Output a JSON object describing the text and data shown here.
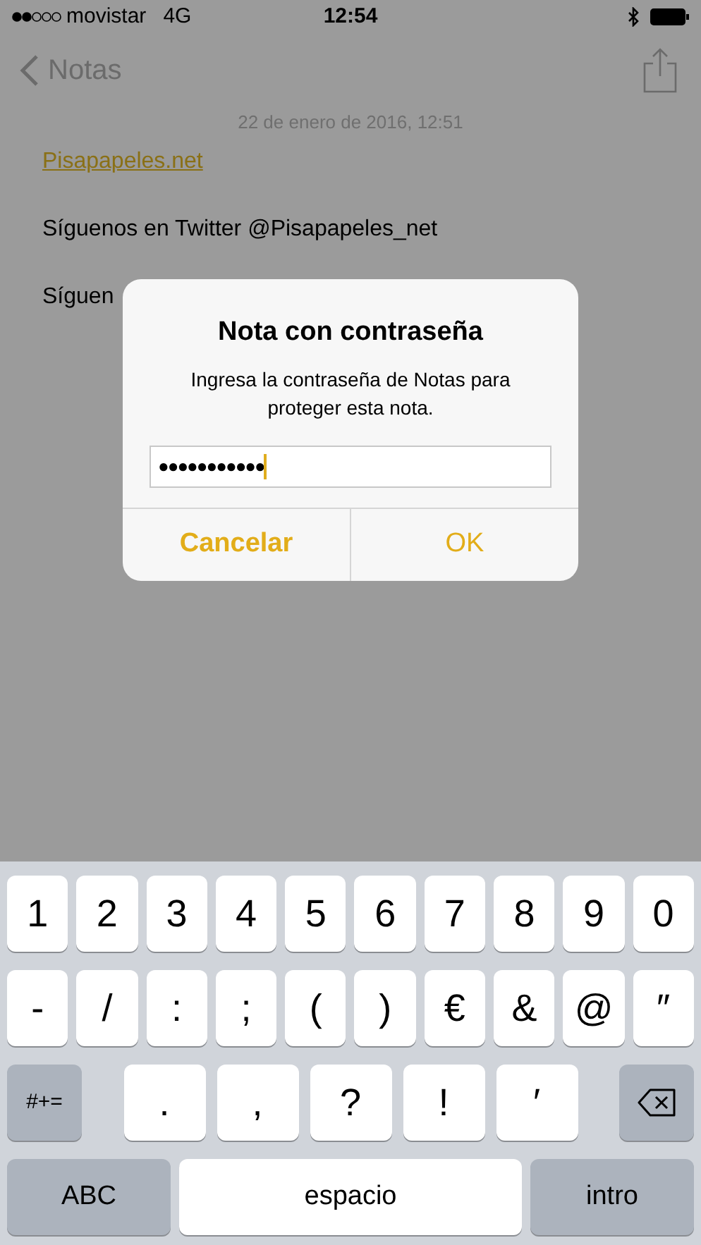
{
  "status_bar": {
    "carrier": "movistar",
    "network": "4G",
    "time": "12:54"
  },
  "nav": {
    "back": "Notas"
  },
  "note": {
    "date": "22 de enero de 2016, 12:51",
    "lines": [
      {
        "kind": "link",
        "text": "Pisapapeles.net"
      },
      {
        "kind": "text",
        "text": "Síguenos en Twitter @Pisapapeles_net"
      },
      {
        "kind": "text",
        "text": "Síguen"
      }
    ]
  },
  "dialog": {
    "title": "Nota con contraseña",
    "message": "Ingresa la contraseña de Notas para proteger esta nota.",
    "password": {
      "value": "●●●●●●●●●●●"
    },
    "buttons": [
      {
        "label": "Cancelar",
        "kind": "cancel"
      },
      {
        "label": "OK",
        "kind": "default"
      }
    ]
  },
  "keyboard": {
    "rows": [
      {
        "keys": [
          {
            "kind": "char",
            "label": "1"
          },
          {
            "kind": "char",
            "label": "2"
          },
          {
            "kind": "char",
            "label": "3"
          },
          {
            "kind": "char",
            "label": "4"
          },
          {
            "kind": "char",
            "label": "5"
          },
          {
            "kind": "char",
            "label": "6"
          },
          {
            "kind": "char",
            "label": "7"
          },
          {
            "kind": "char",
            "label": "8"
          },
          {
            "kind": "char",
            "label": "9"
          },
          {
            "kind": "char",
            "label": "0"
          }
        ]
      },
      {
        "keys": [
          {
            "kind": "char",
            "label": "-"
          },
          {
            "kind": "char",
            "label": "/"
          },
          {
            "kind": "char",
            "label": ":"
          },
          {
            "kind": "char",
            "label": ";"
          },
          {
            "kind": "char",
            "label": "("
          },
          {
            "kind": "char",
            "label": ")"
          },
          {
            "kind": "char",
            "label": "€"
          },
          {
            "kind": "char",
            "label": "&"
          },
          {
            "kind": "char",
            "label": "@"
          },
          {
            "kind": "char",
            "label": "″"
          }
        ]
      },
      {
        "keys": [
          {
            "kind": "shift",
            "label": "#+="
          },
          {
            "kind": "wide",
            "label": "."
          },
          {
            "kind": "wide",
            "label": ","
          },
          {
            "kind": "wide",
            "label": "?"
          },
          {
            "kind": "wide",
            "label": "!"
          },
          {
            "kind": "wide",
            "label": "′"
          },
          {
            "kind": "delete"
          }
        ]
      },
      {
        "keys": [
          {
            "kind": "mode",
            "label": "ABC"
          },
          {
            "kind": "space",
            "label": "espacio"
          },
          {
            "kind": "mode",
            "label": "intro"
          }
        ]
      }
    ]
  }
}
